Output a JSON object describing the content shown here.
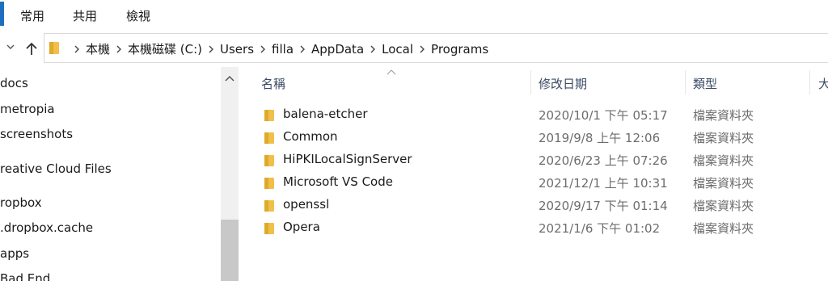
{
  "ribbon": {
    "tabs": [
      "常用",
      "共用",
      "檢視"
    ]
  },
  "address": {
    "crumbs": [
      "本機",
      "本機磁碟 (C:)",
      "Users",
      "filla",
      "AppData",
      "Local",
      "Programs"
    ]
  },
  "nav_pane": {
    "items": [
      "docs",
      "metropia",
      "screenshots",
      "reative Cloud Files",
      "ropbox",
      ".dropbox.cache",
      "apps",
      "Bad End"
    ]
  },
  "content": {
    "columns": {
      "name": "名稱",
      "date": "修改日期",
      "type": "類型",
      "size": "大"
    },
    "rows": [
      {
        "name": "balena-etcher",
        "date": "2020/10/1 下午 05:17",
        "type": "檔案資料夾"
      },
      {
        "name": "Common",
        "date": "2019/9/8 上午 12:06",
        "type": "檔案資料夾"
      },
      {
        "name": "HiPKILocalSignServer",
        "date": "2020/6/23 上午 07:26",
        "type": "檔案資料夾"
      },
      {
        "name": "Microsoft VS Code",
        "date": "2021/12/1 上午 10:31",
        "type": "檔案資料夾"
      },
      {
        "name": "openssl",
        "date": "2020/9/17 下午 01:14",
        "type": "檔案資料夾"
      },
      {
        "name": "Opera",
        "date": "2021/1/6 下午 01:02",
        "type": "檔案資料夾"
      }
    ]
  },
  "colors": {
    "accent": "#1f6fc0",
    "folder": "#f0c04a",
    "header_text": "#3a4a64",
    "meta_text": "#6d6d6d"
  }
}
